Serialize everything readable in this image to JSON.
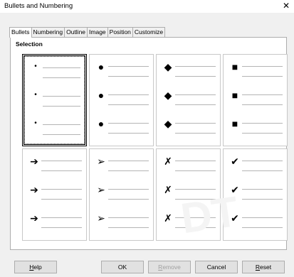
{
  "dialog": {
    "title": "Bullets and Numbering"
  },
  "tabs": [
    {
      "label": "Bullets",
      "active": true
    },
    {
      "label": "Numbering",
      "active": false
    },
    {
      "label": "Outline",
      "active": false
    },
    {
      "label": "Image",
      "active": false
    },
    {
      "label": "Position",
      "active": false
    },
    {
      "label": "Customize",
      "active": false
    }
  ],
  "section_label": "Selection",
  "bullet_styles": [
    {
      "glyph": "•",
      "name": "small-dot",
      "selected": true
    },
    {
      "glyph": "●",
      "name": "large-dot",
      "selected": false
    },
    {
      "glyph": "◆",
      "name": "diamond",
      "selected": false
    },
    {
      "glyph": "■",
      "name": "square",
      "selected": false
    },
    {
      "glyph": "➔",
      "name": "arrow",
      "selected": false
    },
    {
      "glyph": "➢",
      "name": "outline-arrow",
      "selected": false
    },
    {
      "glyph": "✗",
      "name": "x-mark",
      "selected": false
    },
    {
      "glyph": "✔",
      "name": "check-mark",
      "selected": false
    }
  ],
  "buttons": {
    "help": {
      "prefix": "",
      "mnemonic": "H",
      "suffix": "elp",
      "enabled": true
    },
    "ok": {
      "label": "OK",
      "enabled": true
    },
    "remove": {
      "prefix": "",
      "mnemonic": "R",
      "suffix": "emove",
      "enabled": false
    },
    "cancel": {
      "label": "Cancel",
      "enabled": true
    },
    "reset": {
      "prefix": "",
      "mnemonic": "R",
      "suffix": "eset",
      "enabled": true
    }
  }
}
